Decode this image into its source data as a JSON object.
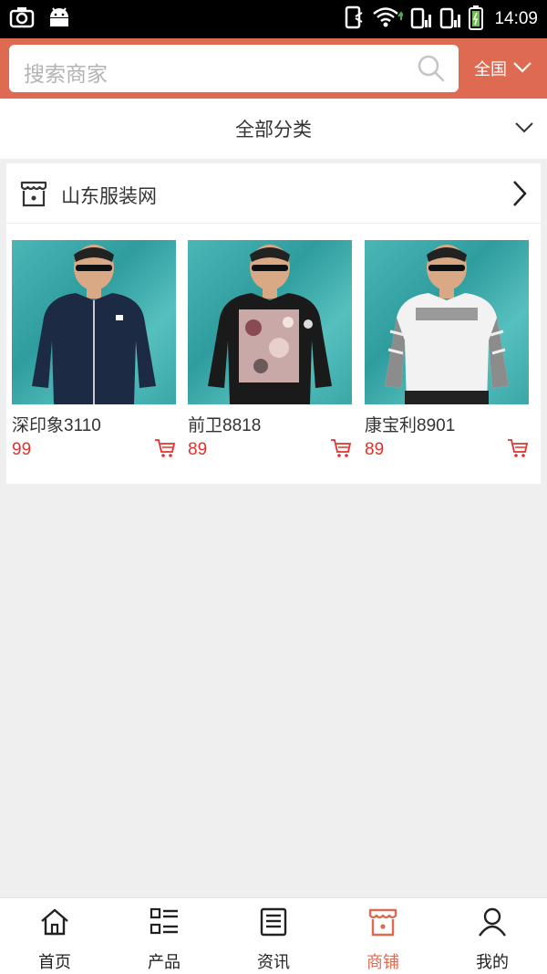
{
  "status_bar": {
    "time": "14:09",
    "icons": [
      "camera-icon",
      "android-icon",
      "sim-icon",
      "wifi-icon",
      "signal-icon",
      "signal-icon",
      "battery-icon"
    ]
  },
  "header": {
    "search_placeholder": "搜索商家",
    "region_label": "全国",
    "accent_color": "#df6a52"
  },
  "category": {
    "label": "全部分类"
  },
  "shop": {
    "name": "山东服装网",
    "products": [
      {
        "name": "深印象3110",
        "price": "99",
        "image": "man-in-navy-zip-cardigan"
      },
      {
        "name": "前卫8818",
        "price": "89",
        "image": "man-in-black-floral-sweatshirt"
      },
      {
        "name": "康宝利8901",
        "price": "89",
        "image": "man-in-white-striped-sweater"
      }
    ]
  },
  "bottom_nav": {
    "items": [
      {
        "label": "首页",
        "icon": "home-icon",
        "active": false
      },
      {
        "label": "产品",
        "icon": "list-icon",
        "active": false
      },
      {
        "label": "资讯",
        "icon": "news-icon",
        "active": false
      },
      {
        "label": "商铺",
        "icon": "store-icon",
        "active": true
      },
      {
        "label": "我的",
        "icon": "user-icon",
        "active": false
      }
    ]
  }
}
